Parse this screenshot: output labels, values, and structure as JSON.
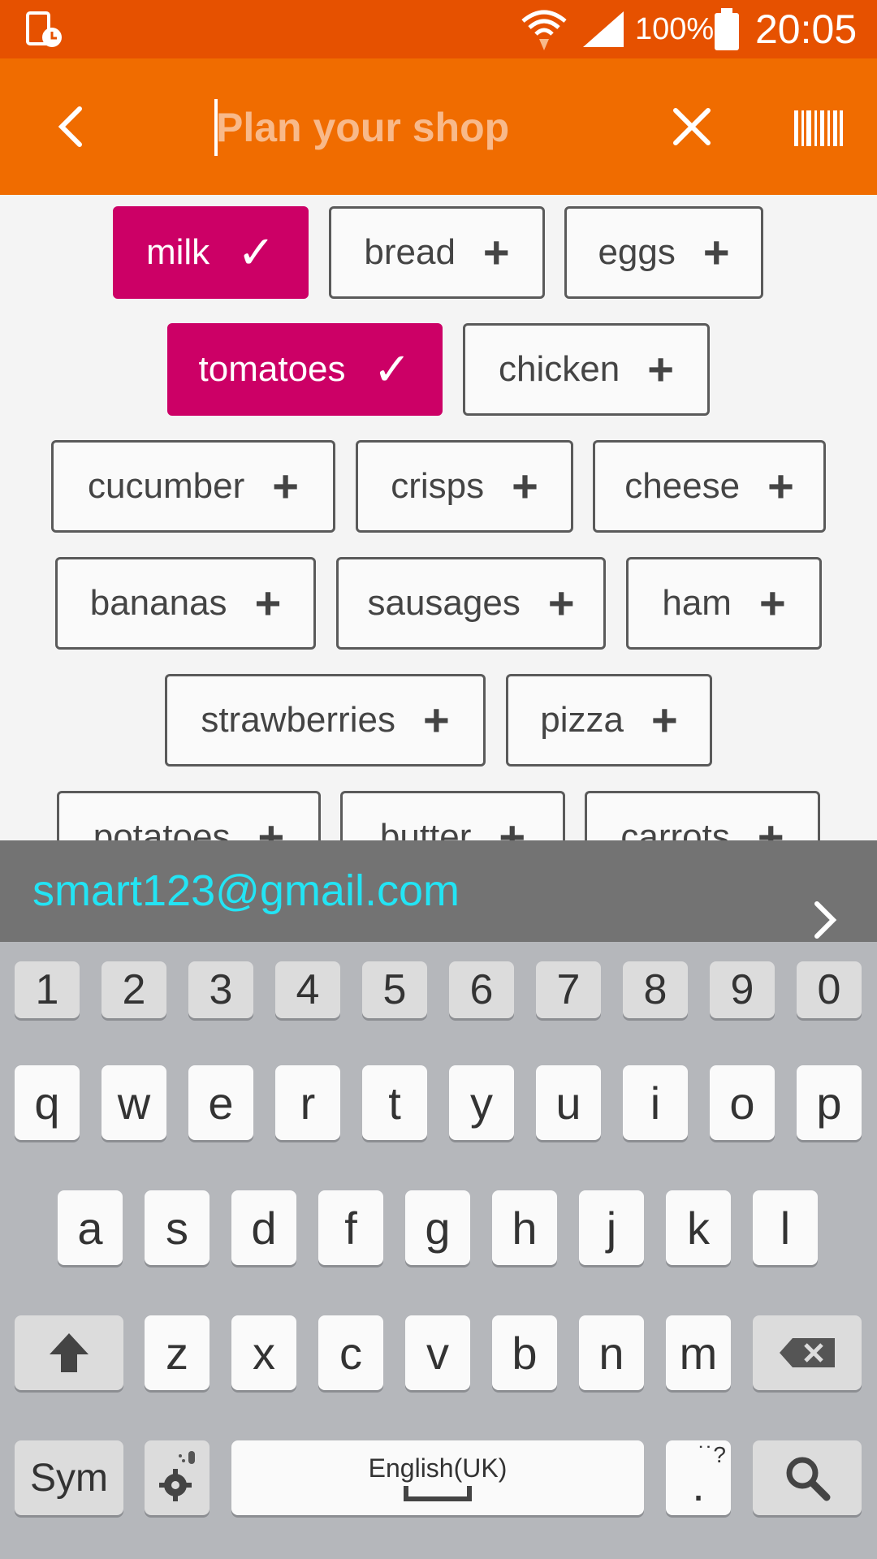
{
  "status_bar": {
    "battery_pct": "100%",
    "time": "20:05"
  },
  "toolbar": {
    "search_placeholder": "Plan your shop"
  },
  "chips": [
    {
      "label": "milk",
      "selected": true
    },
    {
      "label": "bread",
      "selected": false
    },
    {
      "label": "eggs",
      "selected": false
    },
    {
      "label": "tomatoes",
      "selected": true
    },
    {
      "label": "chicken",
      "selected": false
    },
    {
      "label": "cucumber",
      "selected": false
    },
    {
      "label": "crisps",
      "selected": false
    },
    {
      "label": "cheese",
      "selected": false
    },
    {
      "label": "bananas",
      "selected": false
    },
    {
      "label": "sausages",
      "selected": false
    },
    {
      "label": "ham",
      "selected": false
    },
    {
      "label": "strawberries",
      "selected": false
    },
    {
      "label": "pizza",
      "selected": false
    },
    {
      "label": "potatoes",
      "selected": false
    },
    {
      "label": "butter",
      "selected": false
    },
    {
      "label": "carrots",
      "selected": false
    }
  ],
  "suggestion": {
    "email": "smart123@gmail.com"
  },
  "keyboard": {
    "numbers": [
      "1",
      "2",
      "3",
      "4",
      "5",
      "6",
      "7",
      "8",
      "9",
      "0"
    ],
    "row1": [
      "q",
      "w",
      "e",
      "r",
      "t",
      "y",
      "u",
      "i",
      "o",
      "p"
    ],
    "row2": [
      "a",
      "s",
      "d",
      "f",
      "g",
      "h",
      "j",
      "k",
      "l"
    ],
    "row3": [
      "z",
      "x",
      "c",
      "v",
      "b",
      "n",
      "m"
    ],
    "sym_label": "Sym",
    "space_label": "English(UK)",
    "period_label": ".",
    "period_hint": "˙˙?"
  },
  "colors": {
    "status_bar": "#e65100",
    "toolbar": "#f06c00",
    "chip_selected": "#cc0066",
    "suggestion_text": "#23e4f4"
  }
}
